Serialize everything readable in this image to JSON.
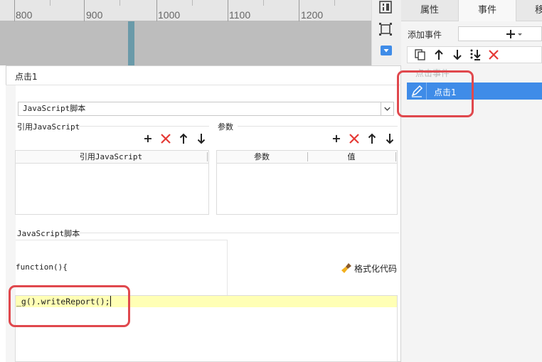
{
  "ruler": {
    "labels": [
      "800",
      "900",
      "1000",
      "1100",
      "1200"
    ]
  },
  "right_panel": {
    "tabs": [
      {
        "label": "属性",
        "active": false
      },
      {
        "label": "事件",
        "active": true
      },
      {
        "label": "移",
        "active": false
      }
    ],
    "add_event_label": "添加事件",
    "add_event_dropdown_icon": "plus-dropdown-icon",
    "toolbar_icons": [
      "copy-icon",
      "arrow-up-icon",
      "arrow-down-icon",
      "move-bottom-icon",
      "delete-icon"
    ],
    "faded_event_label": "点击事件",
    "events": [
      {
        "label": "点击1",
        "selected": true,
        "icon": "pencil-icon"
      }
    ]
  },
  "dialog": {
    "title": "点击1",
    "script_type": "JavaScript脚本",
    "references": {
      "title": "引用JavaScript",
      "column": "引用JavaScript",
      "icons": [
        "add-icon",
        "delete-icon",
        "arrow-up-icon",
        "arrow-down-icon"
      ]
    },
    "params": {
      "title": "参数",
      "columns": [
        "参数",
        "值"
      ],
      "icons": [
        "add-icon",
        "delete-icon",
        "arrow-up-icon",
        "arrow-down-icon"
      ]
    },
    "script_section": {
      "title": "JavaScript脚本",
      "function_header": "function(){",
      "format_button": "格式化代码",
      "format_icon": "broom-icon",
      "code_line": "_g().writeReport();"
    }
  },
  "colors": {
    "accent": "#3f8ce8",
    "callout": "#e0484d",
    "delete": "#e53935",
    "code_highlight": "#ffffb5"
  }
}
